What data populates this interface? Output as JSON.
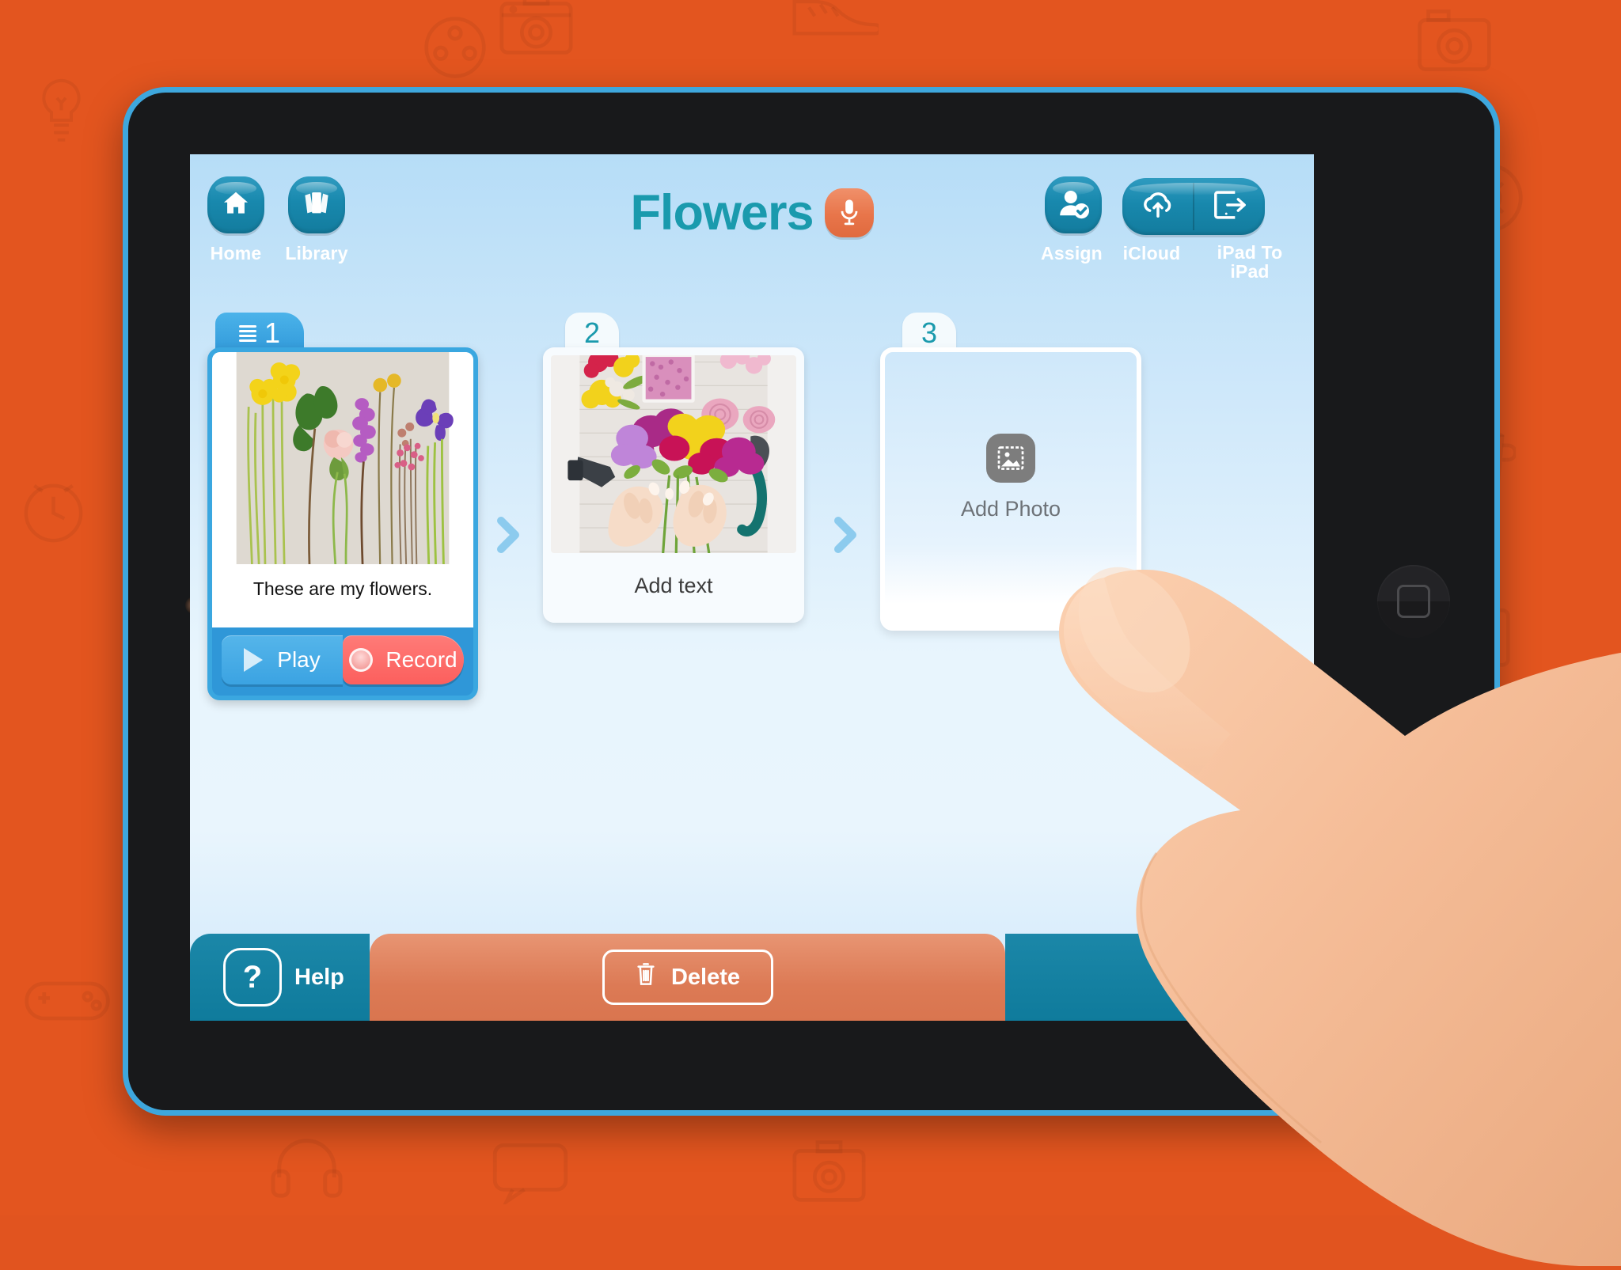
{
  "app": {
    "title": "Flowers",
    "mic_icon": "microphone-icon",
    "accent_teal": "#1a9aad",
    "accent_blue": "#3aa7e0",
    "accent_orange": "#e3551f",
    "record_red": "#fb5f5d"
  },
  "header": {
    "home_label": "Home",
    "home_icon": "home-icon",
    "library_label": "Library",
    "library_icon": "library-cards-icon",
    "assign_label": "Assign",
    "assign_icon": "user-check-icon",
    "icloud_label": "iCloud",
    "icloud_icon": "cloud-upload-icon",
    "ipad_to_ipad_label": "iPad To iPad",
    "ipad_to_ipad_icon": "ipad-export-icon"
  },
  "cards": [
    {
      "number": "1",
      "tab_icon": "list-lines-icon",
      "selected": true,
      "photo_alt": "flowers-laid-out-on-grey-paper",
      "caption": "These are my flowers.",
      "play_label": "Play",
      "play_icon": "play-triangle-icon",
      "record_label": "Record",
      "record_icon": "record-circle-icon"
    },
    {
      "number": "2",
      "selected": false,
      "photo_alt": "hands-arranging-freesia-bouquet",
      "caption": "Add text"
    },
    {
      "number": "3",
      "selected": false,
      "empty": true,
      "placeholder_icon": "photo-frame-icon",
      "placeholder_label": "Add Photo"
    }
  ],
  "connectors": [
    {
      "icon": "chevron-right-icon"
    },
    {
      "icon": "chevron-right-icon"
    }
  ],
  "toolbar": {
    "help_label": "Help",
    "help_icon": "question-mark-icon",
    "delete_label": "Delete",
    "delete_icon": "trash-icon"
  },
  "device": {
    "camera_icon": "front-camera-dot",
    "home_button_icon": "home-button-square"
  },
  "backdrop": {
    "pattern_icons": [
      "lightbulb-icon",
      "camera-icon",
      "sneaker-icon",
      "camera-retro-icon",
      "gamepad-icon",
      "donut-icon",
      "clock-icon",
      "cup-icon",
      "battery-icon",
      "gamepad-icon",
      "headphones-icon",
      "chat-icon",
      "film-reel-icon"
    ]
  }
}
